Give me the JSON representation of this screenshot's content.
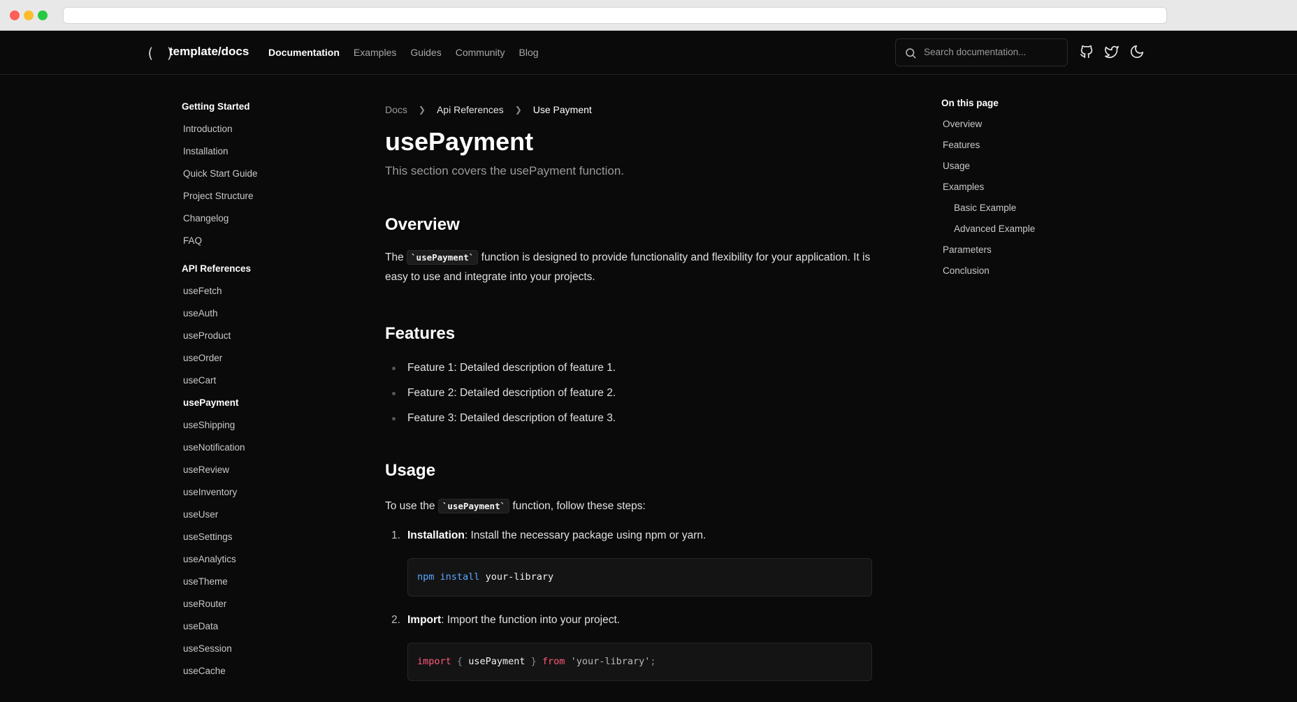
{
  "brand": {
    "mark": "( )",
    "name": "template/docs"
  },
  "nav": {
    "links": [
      "Documentation",
      "Examples",
      "Guides",
      "Community",
      "Blog"
    ],
    "active": "Documentation"
  },
  "search": {
    "placeholder": "Search documentation..."
  },
  "icons": {
    "search": "search-icon",
    "github": "github-icon",
    "twitter": "twitter-icon",
    "theme": "moon-icon"
  },
  "sidebar": {
    "groups": [
      {
        "title": "Getting Started",
        "items": [
          "Introduction",
          "Installation",
          "Quick Start Guide",
          "Project Structure",
          "Changelog",
          "FAQ"
        ]
      },
      {
        "title": "API References",
        "items": [
          "useFetch",
          "useAuth",
          "useProduct",
          "useOrder",
          "useCart",
          "usePayment",
          "useShipping",
          "useNotification",
          "useReview",
          "useInventory",
          "useUser",
          "useSettings",
          "useAnalytics",
          "useTheme",
          "useRouter",
          "useData",
          "useSession",
          "useCache"
        ]
      }
    ],
    "active_item": "usePayment"
  },
  "breadcrumb": [
    "Docs",
    "Api References",
    "Use Payment"
  ],
  "page": {
    "title": "usePayment",
    "lead": "This section covers the usePayment function.",
    "overview": {
      "heading": "Overview",
      "pre": "The ",
      "code": "`usePayment`",
      "post": " function is designed to provide functionality and flexibility for your application. It is easy to use and integrate into your projects."
    },
    "features": {
      "heading": "Features",
      "items": [
        "Feature 1: Detailed description of feature 1.",
        "Feature 2: Detailed description of feature 2.",
        "Feature 3: Detailed description of feature 3."
      ]
    },
    "usage": {
      "heading": "Usage",
      "pre": "To use the ",
      "code": "`usePayment`",
      "post": " function, follow these steps:",
      "steps": [
        {
          "num": "1.",
          "label": "Installation",
          "text": ": Install the necessary package using npm or yarn."
        },
        {
          "num": "2.",
          "label": "Import",
          "text": ": Import the function into your project."
        }
      ],
      "code1": {
        "cmd": "npm",
        "sub": "install",
        "arg": "your-library"
      },
      "code2": {
        "kw": "import",
        "lb": "{",
        "name": "usePayment",
        "rb": "}",
        "from": "from",
        "str": "'your-library'",
        "semi": ";"
      }
    }
  },
  "toc": {
    "title": "On this page",
    "items": [
      {
        "label": "Overview",
        "sub": false
      },
      {
        "label": "Features",
        "sub": false
      },
      {
        "label": "Usage",
        "sub": false
      },
      {
        "label": "Examples",
        "sub": false
      },
      {
        "label": "Basic Example",
        "sub": true
      },
      {
        "label": "Advanced Example",
        "sub": true
      },
      {
        "label": "Parameters",
        "sub": false
      },
      {
        "label": "Conclusion",
        "sub": false
      }
    ]
  }
}
